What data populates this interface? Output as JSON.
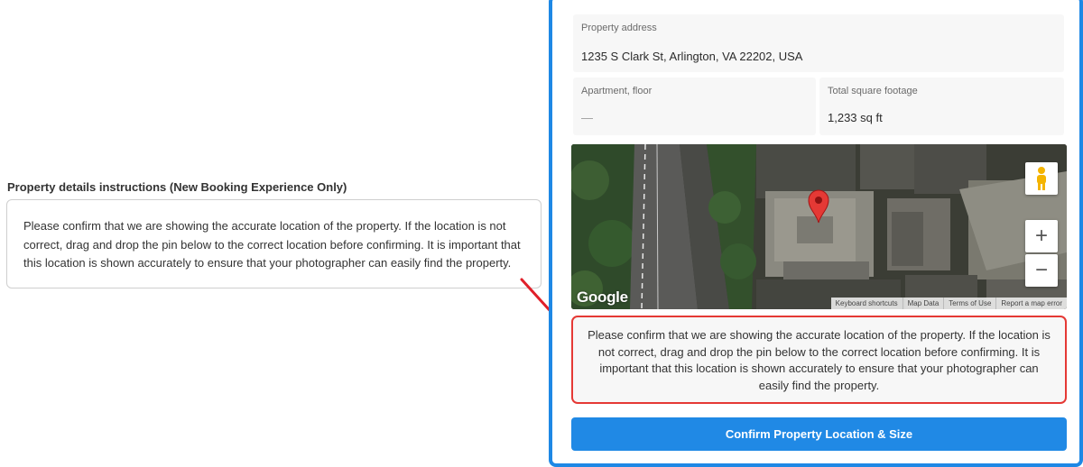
{
  "instructions": {
    "heading": "Property details instructions (New Booking Experience Only)",
    "text": "Please confirm that we are showing the accurate location of the property. If the location is not correct, drag and drop the pin below to the correct location before confirming. It is important that this location is shown accurately to ensure that your photographer can easily find the property."
  },
  "form": {
    "address": {
      "label": "Property address",
      "value": "1235 S Clark St, Arlington, VA 22202, USA"
    },
    "apartment": {
      "label": "Apartment, floor",
      "value": "—"
    },
    "footage": {
      "label": "Total square footage",
      "value": "1,233 sq ft"
    }
  },
  "map": {
    "logo": "Google",
    "footer_links": [
      "Keyboard shortcuts",
      "Map Data",
      "Terms of Use",
      "Report a map error"
    ],
    "controls": {
      "zoom_in": "+",
      "zoom_out": "−",
      "pegman_icon": "pegman-icon",
      "pin_icon": "map-pin-icon"
    },
    "pin_color": "#e53935"
  },
  "warning": {
    "text": "Please confirm that we are showing the accurate location of the property. If the location is not correct, drag and drop the pin below to the correct location before confirming. It is important that this location is shown accurately to ensure that your photographer can easily find the property."
  },
  "confirm_button": {
    "label": "Confirm Property Location & Size"
  },
  "colors": {
    "accent": "#2089e5",
    "frame": "#1e88e5",
    "warning_border": "#e53935",
    "annotation": "#e0202a"
  }
}
